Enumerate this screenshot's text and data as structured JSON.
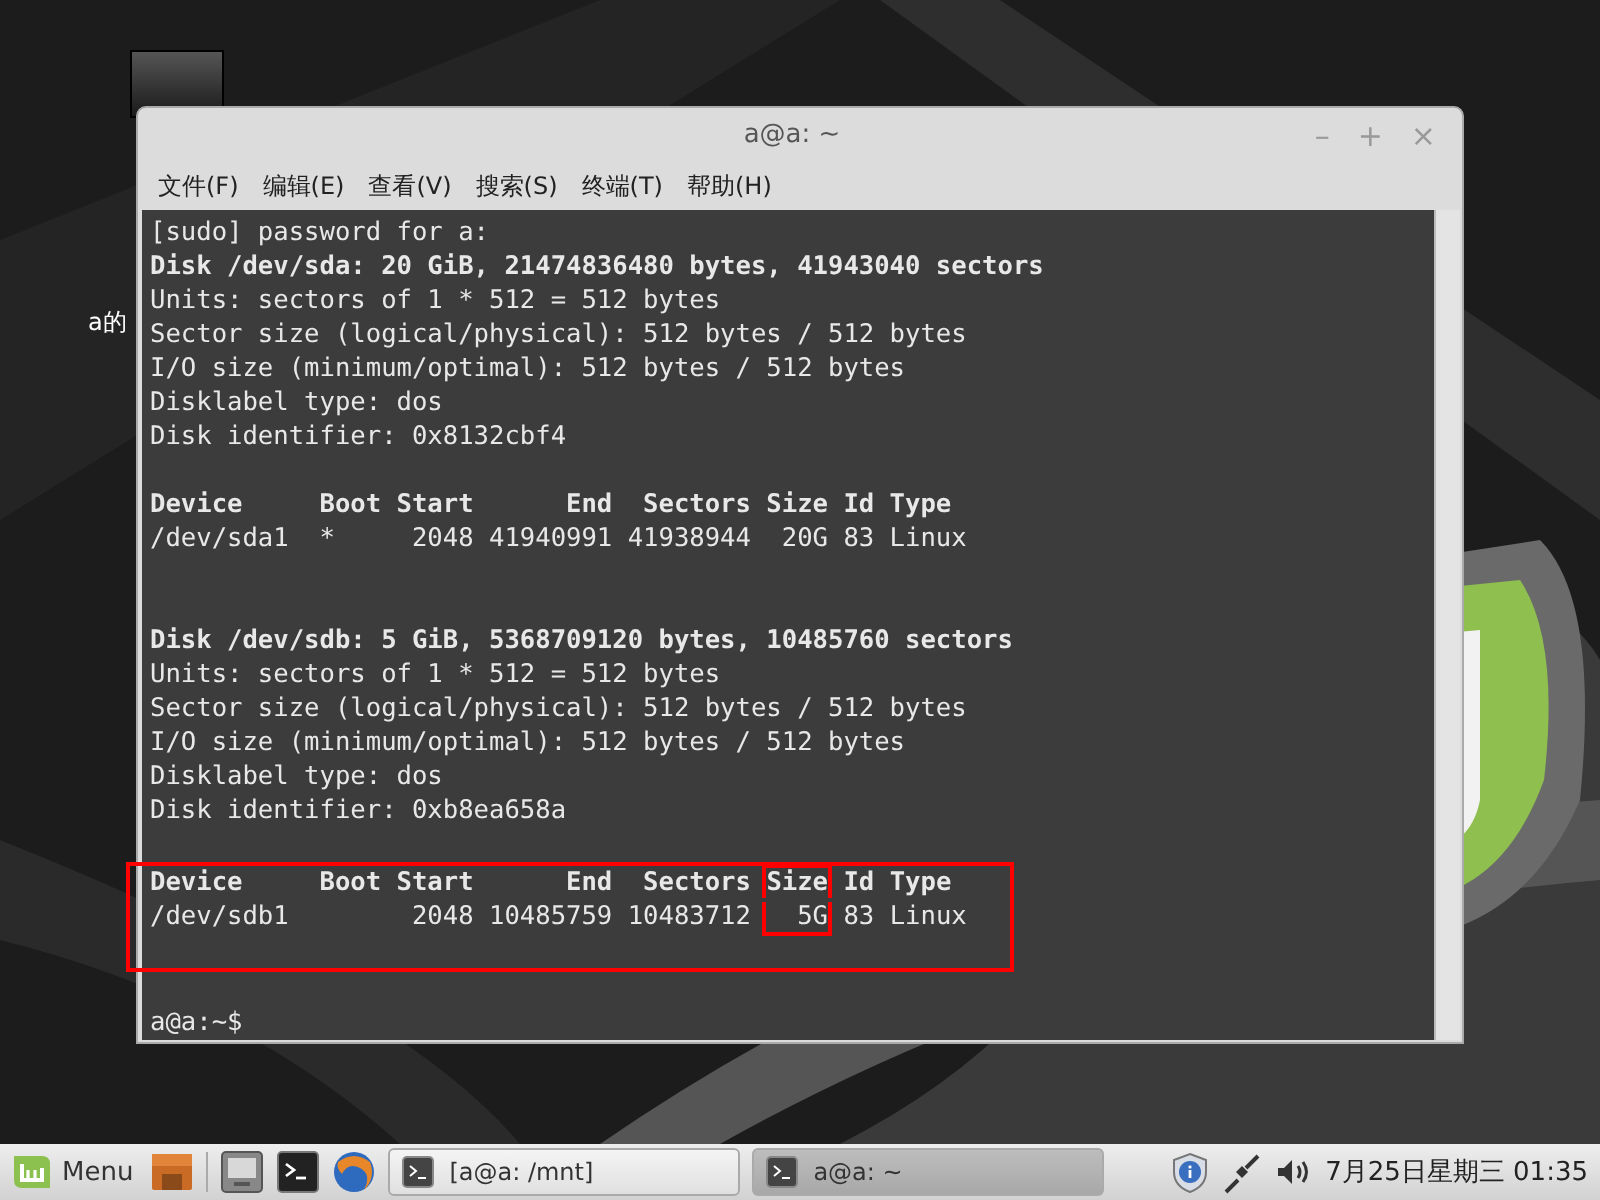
{
  "desktop": {
    "icon_label": "a的"
  },
  "window": {
    "title": "a@a: ~",
    "controls": [
      "–",
      "+",
      "×"
    ],
    "menu": [
      "文件(F)",
      "编辑(E)",
      "查看(V)",
      "搜索(S)",
      "终端(T)",
      "帮助(H)"
    ],
    "lines": [
      {
        "kind": "text",
        "bold": false,
        "segments": [
          {
            "text": "[sudo] password for a:",
            "marked": false
          }
        ]
      },
      {
        "kind": "text",
        "bold": true,
        "segments": [
          {
            "text": "Disk /dev/sda: 20 GiB, 21474836480 bytes, 41943040 sectors",
            "marked": false
          }
        ]
      },
      {
        "kind": "text",
        "bold": false,
        "segments": [
          {
            "text": "Units: sectors of 1 * 512 = 512 bytes",
            "marked": false
          }
        ]
      },
      {
        "kind": "text",
        "bold": false,
        "segments": [
          {
            "text": "Sector size (logical/physical): 512 bytes / 512 bytes",
            "marked": false
          }
        ]
      },
      {
        "kind": "text",
        "bold": false,
        "segments": [
          {
            "text": "I/O size (minimum/optimal): 512 bytes / 512 bytes",
            "marked": false
          }
        ]
      },
      {
        "kind": "text",
        "bold": false,
        "segments": [
          {
            "text": "Disklabel type: dos",
            "marked": false
          }
        ]
      },
      {
        "kind": "text",
        "bold": false,
        "segments": [
          {
            "text": "Disk identifier: 0x8132cbf4",
            "marked": false
          }
        ]
      },
      {
        "kind": "blank"
      },
      {
        "kind": "text",
        "bold": true,
        "segments": [
          {
            "text": "Device     Boot Start      End  Sectors Size Id Type",
            "marked": false
          }
        ]
      },
      {
        "kind": "text",
        "bold": false,
        "segments": [
          {
            "text": "/dev/sda1  *     2048 41940991 41938944  20G 83 Linux",
            "marked": false
          }
        ]
      },
      {
        "kind": "blank"
      },
      {
        "kind": "blank"
      },
      {
        "kind": "text",
        "bold": true,
        "segments": [
          {
            "text": "Disk /dev/sdb: 5 GiB, 5368709120 bytes, 10485760 sectors",
            "marked": false
          }
        ]
      },
      {
        "kind": "text",
        "bold": false,
        "segments": [
          {
            "text": "Units: sectors of 1 * 512 = 512 bytes",
            "marked": false
          }
        ]
      },
      {
        "kind": "text",
        "bold": false,
        "segments": [
          {
            "text": "Sector size (logical/physical): 512 bytes / 512 bytes",
            "marked": false
          }
        ]
      },
      {
        "kind": "text",
        "bold": false,
        "segments": [
          {
            "text": "I/O size (minimum/optimal): 512 bytes / 512 bytes",
            "marked": false
          }
        ]
      },
      {
        "kind": "text",
        "bold": false,
        "segments": [
          {
            "text": "Disklabel type: dos",
            "marked": false
          }
        ]
      },
      {
        "kind": "text",
        "bold": false,
        "segments": [
          {
            "text": "Disk identifier: 0xb8ea658a",
            "marked": false
          }
        ]
      },
      {
        "kind": "blank"
      },
      {
        "kind": "highlight",
        "lines": [
          {
            "kind": "text",
            "bold": true,
            "segments": [
              {
                "text": "Device     Boot Start      End  Sectors ",
                "marked": false
              },
              {
                "text": "Size",
                "marked": true
              },
              {
                "text": " Id Type",
                "marked": false
              }
            ]
          },
          {
            "kind": "text",
            "bold": false,
            "segments": [
              {
                "text": "/dev/sdb1        2048 10485759 10483712 ",
                "marked": false
              },
              {
                "text": "  5G",
                "marked": true
              },
              {
                "text": " 83 Linux",
                "marked": false
              }
            ]
          },
          {
            "kind": "blank"
          }
        ]
      },
      {
        "kind": "blank"
      },
      {
        "kind": "text",
        "bold": false,
        "segments": [
          {
            "text": "a@a:~$",
            "marked": false
          }
        ]
      }
    ]
  },
  "taskbar": {
    "menu_label": "Menu",
    "launchers": [
      {
        "kind": "folder"
      },
      {
        "kind": "desktop"
      },
      {
        "kind": "terminal"
      },
      {
        "kind": "browser"
      }
    ],
    "windows": [
      {
        "label": "[a@a: /mnt]",
        "selected": false
      },
      {
        "label": "a@a: ~",
        "selected": true
      }
    ],
    "tray": [
      {
        "kind": "shield"
      },
      {
        "kind": "network"
      },
      {
        "kind": "volume"
      }
    ],
    "clock": "7月25日星期三 01:35"
  }
}
